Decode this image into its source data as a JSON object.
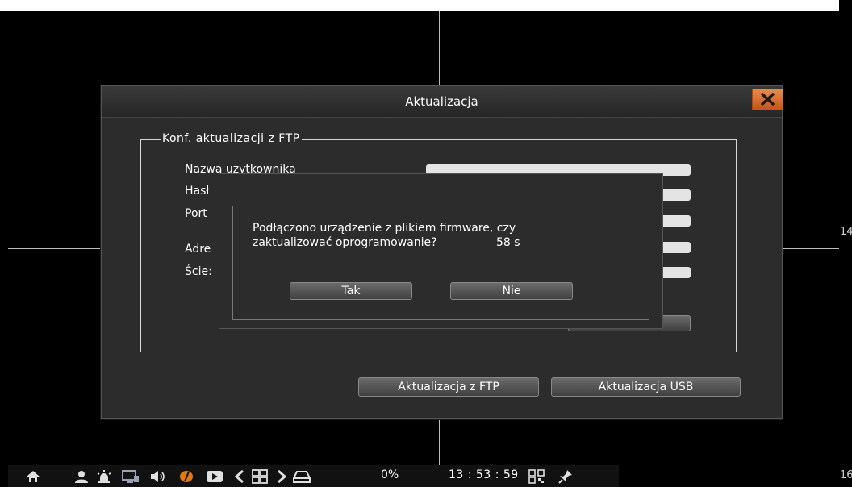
{
  "window": {
    "title": "Aktualizacja"
  },
  "ftp_group": {
    "legend": "Konf. aktualizacji z FTP",
    "fields": [
      {
        "label": "Nazwa użytkownika",
        "value": ""
      },
      {
        "label": "Hasł",
        "value": ""
      },
      {
        "label": "Port",
        "value": ""
      },
      {
        "label": "Adre",
        "value": ""
      },
      {
        "label": "Ście:",
        "value": ""
      }
    ]
  },
  "buttons": {
    "ftp_update": "Aktualizacja z FTP",
    "usb_update": "Aktualizacja USB"
  },
  "dialog": {
    "message_line1": "Podłączono urządzenie z plikiem firmware, czy",
    "message_line2": "zaktualizować oprogramowanie?",
    "countdown": "58 s",
    "yes_label": "Tak",
    "no_label": "Nie"
  },
  "taskbar": {
    "percent": "0%",
    "clock": "13 : 53 : 59",
    "icons": [
      "home-icon",
      "user-icon",
      "alarm-icon",
      "monitor-icon",
      "speaker-icon",
      "record-icon",
      "playback-icon",
      "prev-icon",
      "grid-icon",
      "next-icon",
      "hdd-icon",
      "qr-icon",
      "pin-icon"
    ]
  },
  "edge_labels": {
    "right_middle": "14",
    "right_bottom": "16"
  },
  "colors": {
    "close_button": "#d0601e",
    "window_bg": "#2c2c2c",
    "field_bg": "#e4e4e4",
    "record_icon": "#e07a10"
  }
}
